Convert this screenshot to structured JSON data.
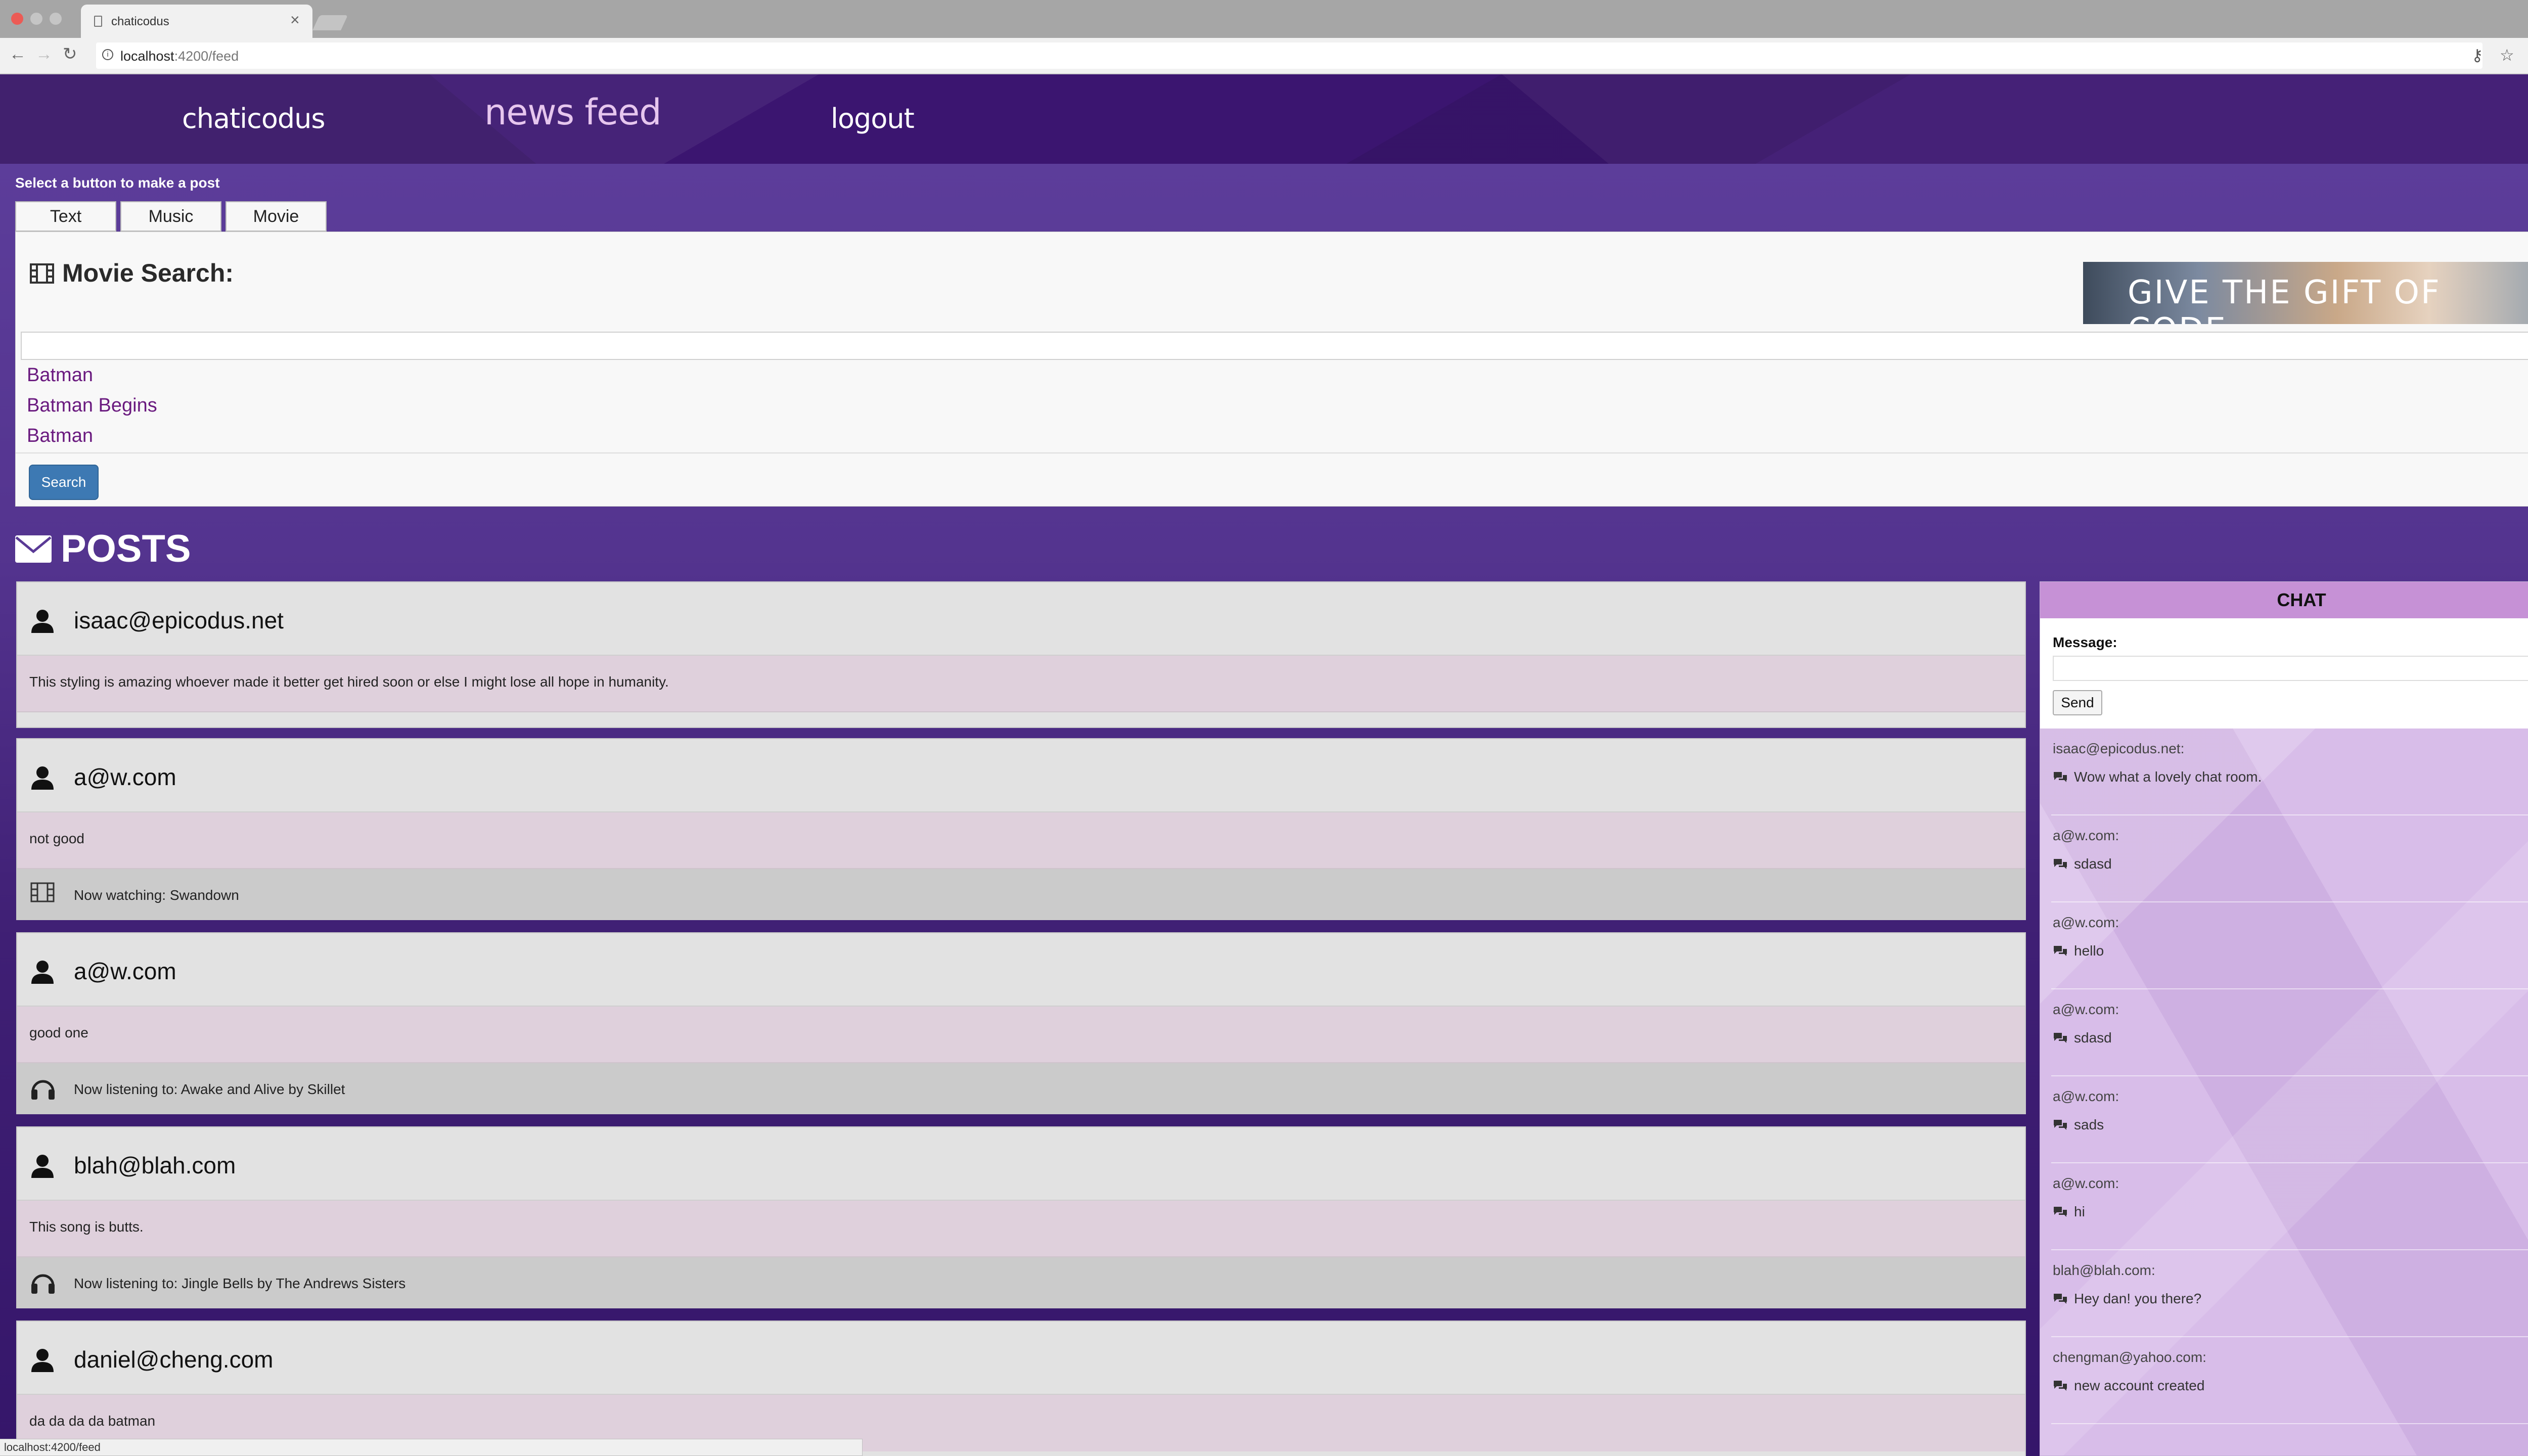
{
  "browser": {
    "tab_title": "chaticodus",
    "url_host": "localhost",
    "url_path": ":4200/feed",
    "status_url": "localhost:4200/feed"
  },
  "nav": {
    "brand": "chaticodus",
    "news_feed": "news feed",
    "logout": "logout"
  },
  "composer": {
    "prompt": "Select a button to make a post",
    "types": [
      "Text",
      "Music",
      "Movie"
    ]
  },
  "movie_search": {
    "heading": "Movie Search:",
    "banner_text": "GIVE THE GIFT OF CODE",
    "input_value": "",
    "results": [
      "Batman",
      "Batman Begins",
      "Batman"
    ],
    "button": "Search"
  },
  "posts_heading": "POSTS",
  "posts": [
    {
      "author": "isaac@epicodus.net",
      "text": "This styling is amazing whoever made it better get hired soon or else I might lose all hope in humanity.",
      "media": "",
      "media_icon": ""
    },
    {
      "author": "a@w.com",
      "text": "not good",
      "media": "Now watching: Swandown",
      "media_icon": "film-icon"
    },
    {
      "author": "a@w.com",
      "text": "good one",
      "media": "Now listening to: Awake and Alive by Skillet",
      "media_icon": "headphones-icon"
    },
    {
      "author": "blah@blah.com",
      "text": "This song is butts.",
      "media": "Now listening to: Jingle Bells by The Andrews Sisters",
      "media_icon": "headphones-icon"
    },
    {
      "author": "daniel@cheng.com",
      "text": "da da da da batman",
      "media": "",
      "media_icon": ""
    }
  ],
  "chat": {
    "title": "CHAT",
    "message_label": "Message:",
    "message_value": "",
    "send": "Send",
    "messages": [
      {
        "author": "isaac@epicodus.net:",
        "text": "Wow what a lovely chat room."
      },
      {
        "author": "a@w.com:",
        "text": "sdasd"
      },
      {
        "author": "a@w.com:",
        "text": "hello"
      },
      {
        "author": "a@w.com:",
        "text": "sdasd"
      },
      {
        "author": "a@w.com:",
        "text": "sads"
      },
      {
        "author": "a@w.com:",
        "text": "hi"
      },
      {
        "author": "blah@blah.com:",
        "text": "Hey dan! you there?"
      },
      {
        "author": "chengman@yahoo.com:",
        "text": "new account created"
      }
    ]
  },
  "colors": {
    "nav_bg": "#3b1570",
    "page_purple": "#5a3a96",
    "link_purple": "#6a1a7f",
    "chat_header": "#c691d6",
    "search_button": "#3d79b3"
  }
}
